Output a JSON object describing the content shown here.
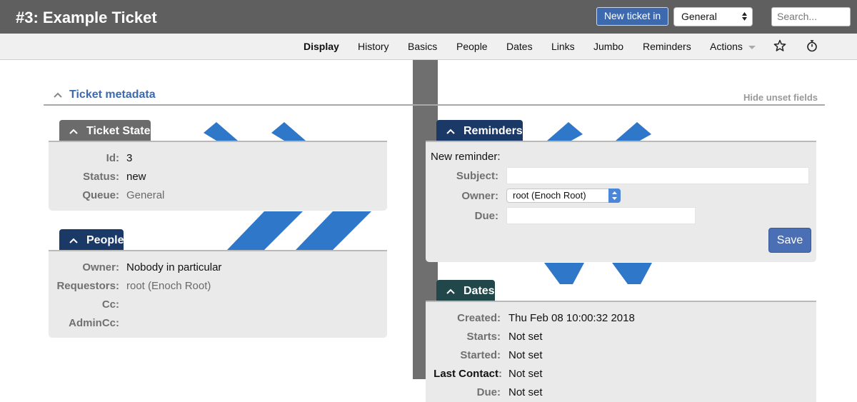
{
  "header": {
    "title": "#3: Example Ticket",
    "new_ticket_label": "New ticket in",
    "queue_value": "General",
    "search_placeholder": "Search..."
  },
  "nav": {
    "items": [
      "Display",
      "History",
      "Basics",
      "People",
      "Dates",
      "Links",
      "Jumbo",
      "Reminders",
      "Actions"
    ],
    "active": "Display",
    "icons": [
      "star-icon",
      "stopwatch-icon"
    ]
  },
  "metadata": {
    "title": "Ticket metadata",
    "hide_unset": "Hide unset fields"
  },
  "ticket_state": {
    "title": "Ticket State",
    "fields": [
      {
        "label": "Id:",
        "value": "3"
      },
      {
        "label": "Status:",
        "value": "new"
      },
      {
        "label": "Queue:",
        "value": "General"
      }
    ]
  },
  "people": {
    "title": "People",
    "fields": [
      {
        "label": "Owner:",
        "value": "Nobody in particular"
      },
      {
        "label": "Requestors:",
        "value": "root (Enoch Root)"
      },
      {
        "label": "Cc:",
        "value": ""
      },
      {
        "label": "AdminCc:",
        "value": ""
      }
    ]
  },
  "reminders": {
    "title": "Reminders",
    "intro": "New reminder:",
    "subject_label": "Subject:",
    "subject_value": "",
    "owner_label": "Owner:",
    "owner_value": "root (Enoch Root)",
    "due_label": "Due:",
    "due_value": "",
    "save_label": "Save"
  },
  "dates": {
    "title": "Dates",
    "fields": [
      {
        "label": "Created:",
        "value": "Thu Feb 08 10:00:32 2018"
      },
      {
        "label": "Starts:",
        "value": "Not set"
      },
      {
        "label": "Started:",
        "value": "Not set"
      },
      {
        "label": "Last Contact",
        "value": "Not set"
      },
      {
        "label": "Due:",
        "value": "Not set"
      }
    ]
  },
  "colors": {
    "header_bg": "#5f5f5f",
    "accent_blue": "#3d69ae",
    "tab_grey": "#6b6b6b",
    "tab_navy": "#1b3966",
    "tab_teal": "#21474a",
    "deco_blue": "#2f77c8"
  }
}
